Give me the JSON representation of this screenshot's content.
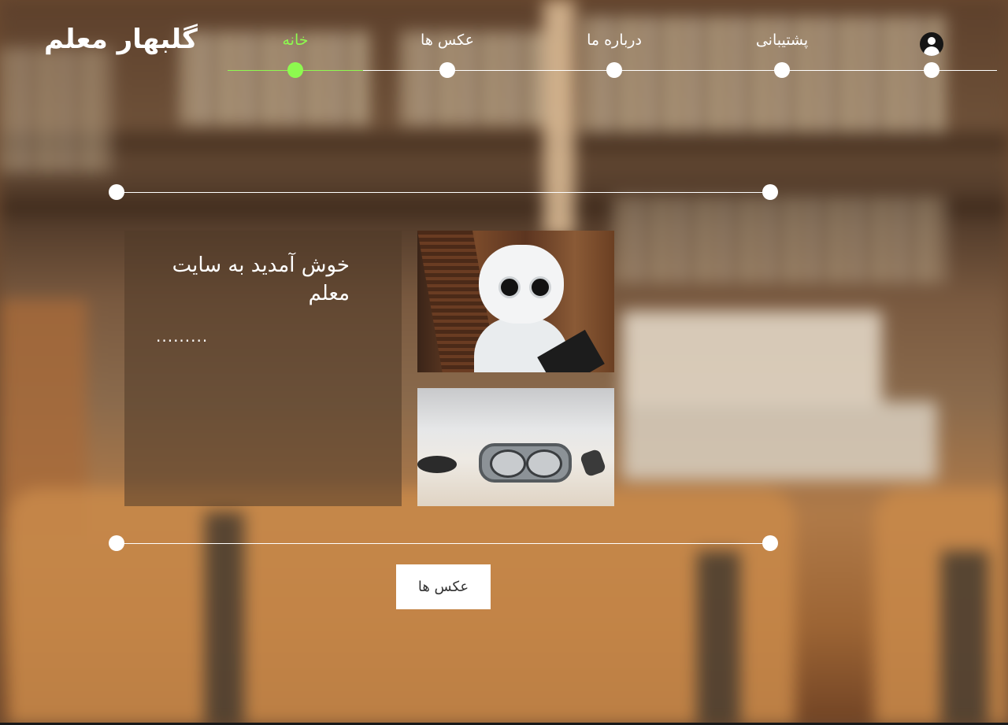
{
  "header": {
    "logo": "گلبهار معلم",
    "nav": [
      {
        "label": "خانه",
        "active": true
      },
      {
        "label": "عکس ها",
        "active": false
      },
      {
        "label": "درباره ما",
        "active": false
      },
      {
        "label": "پشتیبانی",
        "active": false
      }
    ],
    "user_icon": "user-circle-icon"
  },
  "main": {
    "welcome_title": "خوش آمدید به سایت معلم",
    "welcome_text": ".........",
    "photos": [
      {
        "name": "robot-photo"
      },
      {
        "name": "ar-glasses-photo"
      }
    ],
    "photos_button": "عکس ها"
  },
  "colors": {
    "accent": "#8dfa4f",
    "text": "#ffffff",
    "button_bg": "#ffffff",
    "button_text": "#333333"
  }
}
